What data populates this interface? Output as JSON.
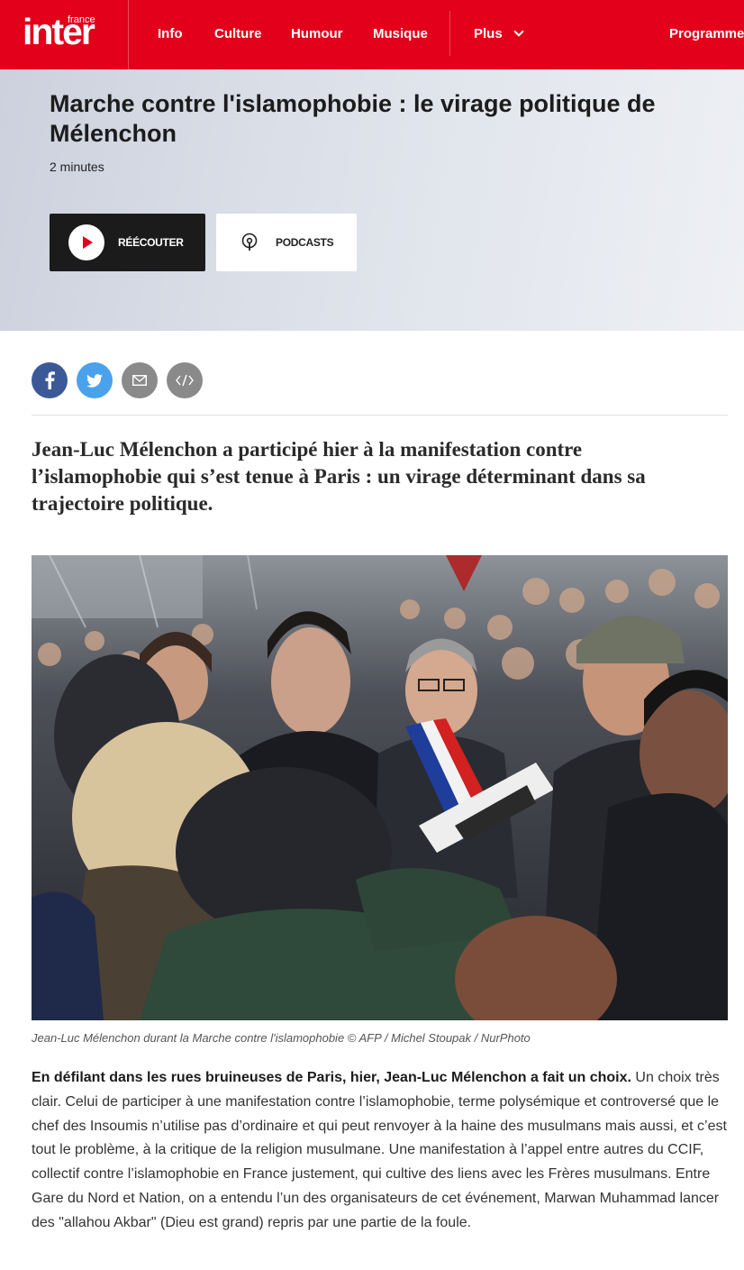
{
  "nav": {
    "logo_small": "france",
    "logo_big": "inter",
    "items": [
      "Info",
      "Culture",
      "Humour",
      "Musique"
    ],
    "more_label": "Plus",
    "program_label": "Programmes"
  },
  "hero": {
    "title": "Marche contre l'islamophobie : le virage politique de Mélenchon",
    "duration": "2 minutes",
    "listen_label": "RÉÉCOUTER",
    "podcasts_label": "PODCASTS"
  },
  "share": {
    "icons": [
      "facebook-icon",
      "twitter-icon",
      "email-icon",
      "embed-icon"
    ],
    "colors": {
      "facebook": "#3b5998",
      "twitter": "#4aa1ec",
      "email": "#8a8a8a",
      "embed": "#8a8a8a"
    }
  },
  "article": {
    "lead": "Jean-Luc Mélenchon a participé hier à la manifestation contre l’islamophobie qui s’est tenue à Paris : un virage déterminant dans sa trajectoire politique.",
    "caption": "Jean-Luc Mélenchon durant la Marche contre l'islamophobie © AFP / Michel Stoupak / NurPhoto",
    "body_strong": "En défilant dans les rues bruineuses de Paris, hier, Jean-Luc Mélenchon a fait un choix.",
    "body_rest": " Un choix très clair. Celui de participer à une manifestation contre l’islamophobie, terme polysémique et controversé que le chef des Insoumis n’utilise pas d’ordinaire et qui peut renvoyer à la haine des musulmans mais aussi, et c’est tout le problème, à la critique de la religion musulmane. Une manifestation à l’appel entre autres du CCIF, collectif contre l’islamophobie en France justement, qui cultive des liens avec les Frères musulmans. Entre Gare du Nord et Nation, on a entendu l’un des organisateurs de cet événement, Marwan Muhammad lancer des \"allahou Akbar\" (Dieu est grand) repris par une partie de la foule."
  },
  "colors": {
    "brand": "#e2001a",
    "dark_button": "#1b1b1b"
  }
}
